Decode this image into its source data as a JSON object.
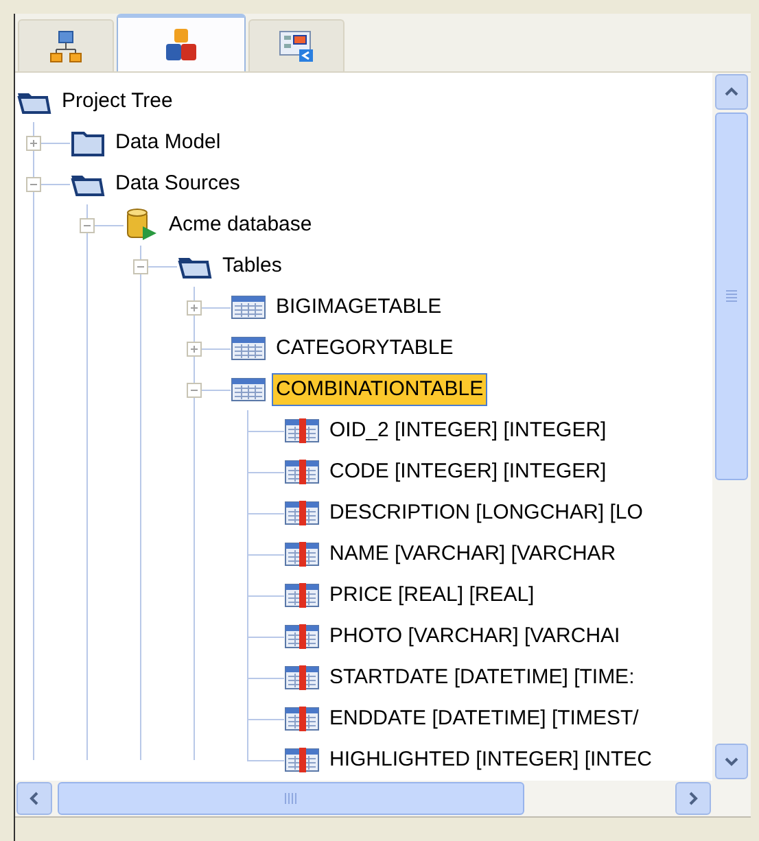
{
  "tabs": [
    {
      "selected": false
    },
    {
      "selected": true
    },
    {
      "selected": false
    }
  ],
  "tree": {
    "label": "Project Tree",
    "kind": "folder",
    "selected": false,
    "children": [
      {
        "label": "Data Model",
        "kind": "folder",
        "expanded": false,
        "selected": false
      },
      {
        "label": "Data Sources",
        "kind": "folder",
        "expanded": true,
        "selected": false,
        "children": [
          {
            "label": "Acme database",
            "kind": "database",
            "expanded": true,
            "selected": false,
            "children": [
              {
                "label": "Tables",
                "kind": "folder",
                "expanded": true,
                "selected": false,
                "children": [
                  {
                    "label": "BIGIMAGETABLE",
                    "kind": "table",
                    "expanded": false,
                    "selected": false
                  },
                  {
                    "label": "CATEGORYTABLE",
                    "kind": "table",
                    "expanded": false,
                    "selected": false
                  },
                  {
                    "label": "COMBINATIONTABLE",
                    "kind": "table",
                    "expanded": true,
                    "selected": true,
                    "children": [
                      {
                        "label": "OID_2 [INTEGER] [INTEGER]",
                        "kind": "column",
                        "selected": false
                      },
                      {
                        "label": "CODE [INTEGER] [INTEGER]",
                        "kind": "column",
                        "selected": false
                      },
                      {
                        "label": "DESCRIPTION [LONGCHAR] [LO",
                        "kind": "column",
                        "selected": false
                      },
                      {
                        "label": "NAME [VARCHAR] [VARCHAR",
                        "kind": "column",
                        "selected": false
                      },
                      {
                        "label": "PRICE [REAL] [REAL]",
                        "kind": "column",
                        "selected": false
                      },
                      {
                        "label": "PHOTO [VARCHAR] [VARCHAI",
                        "kind": "column",
                        "selected": false
                      },
                      {
                        "label": "STARTDATE [DATETIME] [TIME:",
                        "kind": "column",
                        "selected": false
                      },
                      {
                        "label": "ENDDATE [DATETIME] [TIMEST/",
                        "kind": "column",
                        "selected": false
                      },
                      {
                        "label": "HIGHLIGHTED [INTEGER] [INTEC",
                        "kind": "column",
                        "selected": false
                      }
                    ]
                  }
                ]
              }
            ]
          }
        ]
      }
    ]
  }
}
